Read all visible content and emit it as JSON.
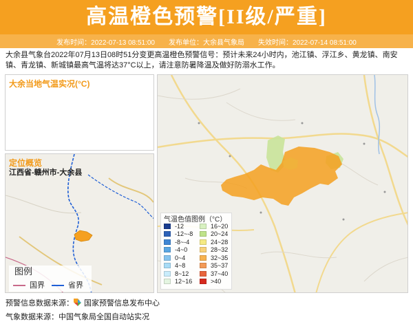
{
  "header": {
    "title": "高温橙色预警[II级/严重]",
    "publish_time_label": "发布时间：2022-07-13 08:51:00",
    "publisher_label": "发布单位：大余县气象局",
    "expire_label": "失效时间：2022-07-14 08:51:00"
  },
  "warning": {
    "content": "大余县气象台2022年07月13日08时51分变更高温橙色预警信号：预计未来24小时内，池江镇、浮江乡、黄龙镇、南安镇、青龙镇、新城镇最高气温将达37°C以上，请注意防暑降温及做好防溺水工作。"
  },
  "temp_panel": {
    "title": "大余当地气温实况(°C)"
  },
  "location_panel": {
    "title": "定位概览",
    "path": "江西省-赣州市-大余县",
    "legend_title": "图例",
    "legend_items": [
      {
        "label": "国界",
        "color": "#c86a8a"
      },
      {
        "label": "省界",
        "color": "#1f5fd6"
      }
    ]
  },
  "map_legend": {
    "title": "气温色值图例（°C）",
    "left": [
      {
        "label": "-12",
        "color": "#1a3d8f"
      },
      {
        "label": "-12~-8",
        "color": "#2d62b8"
      },
      {
        "label": "-8~-4",
        "color": "#3f86d4"
      },
      {
        "label": "-4~0",
        "color": "#5aa6e3"
      },
      {
        "label": "0~4",
        "color": "#86c4ef"
      },
      {
        "label": "4~8",
        "color": "#a8dbf6"
      },
      {
        "label": "8~12",
        "color": "#c9ecfb"
      },
      {
        "label": "12~16",
        "color": "#e4f5e1"
      }
    ],
    "right": [
      {
        "label": "16~20",
        "color": "#d8f1c0"
      },
      {
        "label": "20~24",
        "color": "#bfe38a"
      },
      {
        "label": "24~28",
        "color": "#f5ea83"
      },
      {
        "label": "28~32",
        "color": "#f8d27a"
      },
      {
        "label": "32~35",
        "color": "#f7b24f"
      },
      {
        "label": "35~37",
        "color": "#f39a57"
      },
      {
        "label": "37~40",
        "color": "#e8643c"
      },
      {
        "label": ">40",
        "color": "#d62a1e"
      }
    ]
  },
  "footer": {
    "source_label": "预警信息数据来源：",
    "source_value": "国家预警信息发布中心",
    "weather_label": "气象数据来源：中国气象局全国自动站实况"
  }
}
